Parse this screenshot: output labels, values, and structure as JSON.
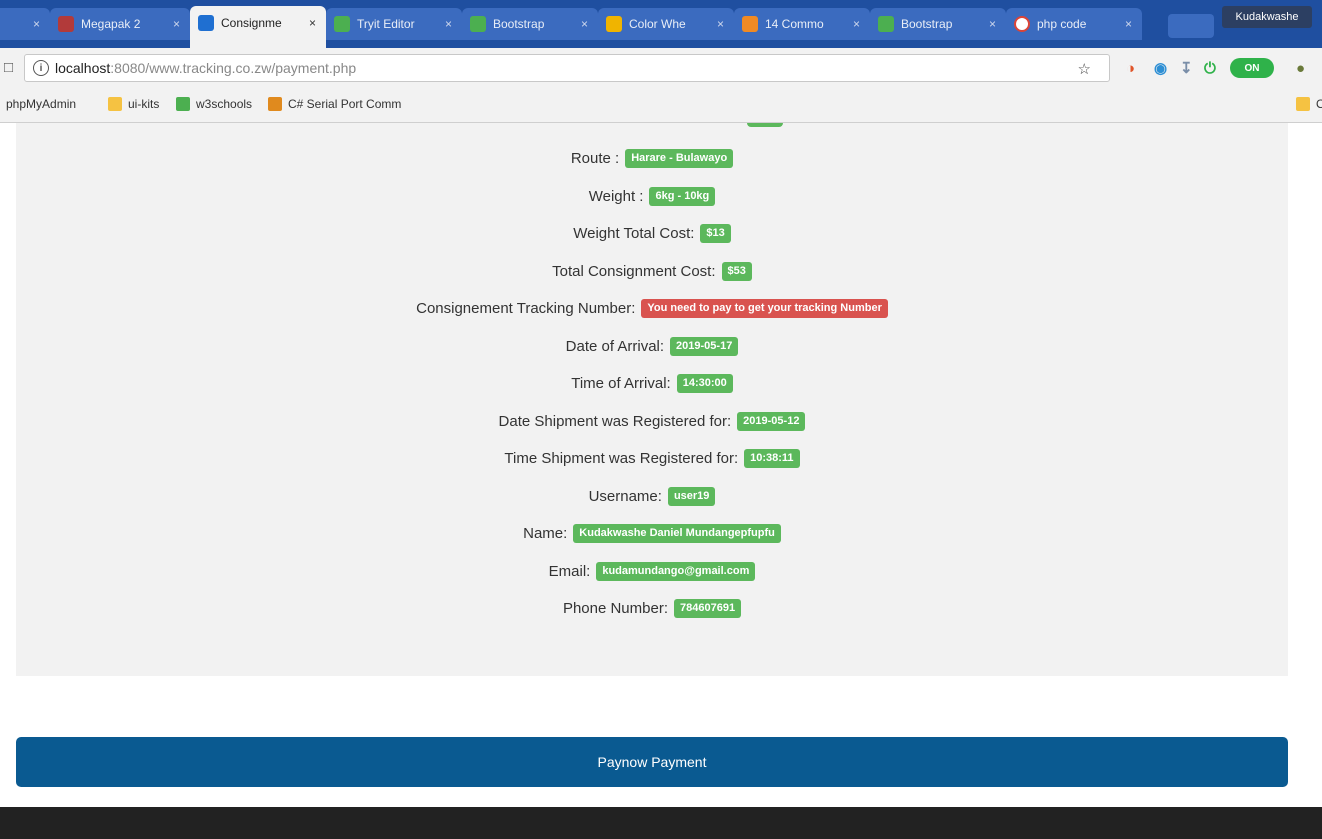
{
  "browser": {
    "tabs": [
      {
        "title": "",
        "favicon_color": "#3b6bbf",
        "active": false
      },
      {
        "title": "Megapak 2",
        "favicon_color": "#b23a3a",
        "active": false
      },
      {
        "title": "Consignme",
        "favicon_color": "#1f6fd1",
        "active": true
      },
      {
        "title": "Tryit Editor",
        "favicon_color": "#4caf50",
        "active": false
      },
      {
        "title": "Bootstrap",
        "favicon_color": "#4caf50",
        "active": false
      },
      {
        "title": "Color Whe",
        "favicon_color": "#f0b400",
        "active": false
      },
      {
        "title": "14 Commo",
        "favicon_color": "#f08a24",
        "active": false
      },
      {
        "title": "Bootstrap",
        "favicon_color": "#4caf50",
        "active": false
      },
      {
        "title": "php code",
        "favicon_color": "#ffffff",
        "active": false
      }
    ],
    "tab_close_glyph": "×",
    "profile_name": "Kudakwashe",
    "url_host": "localhost",
    "url_rest": ":8080/www.tracking.co.zw/payment.php",
    "toggle_label": "ON",
    "bookmarks": [
      {
        "label": "phpMyAdmin",
        "icon_color": ""
      },
      {
        "label": "ui-kits",
        "icon_color": "#f5c242"
      },
      {
        "label": "w3schools",
        "icon_color": "#4caf50"
      },
      {
        "label": "C# Serial Port Comm",
        "icon_color": "#e08a1e"
      }
    ],
    "bookmark_overflow": "O"
  },
  "details": [
    {
      "label": "Route :",
      "value": "Harare - Bulawayo",
      "status": "success"
    },
    {
      "label": "Weight :",
      "value": "6kg - 10kg",
      "status": "success"
    },
    {
      "label": "Weight Total Cost:",
      "value": "$13",
      "status": "success"
    },
    {
      "label": "Total Consignment Cost:",
      "value": "$53",
      "status": "success"
    },
    {
      "label": "Consignement Tracking Number:",
      "value": "You need to pay to get your tracking Number",
      "status": "danger"
    },
    {
      "label": "Date of Arrival:",
      "value": "2019-05-17",
      "status": "success"
    },
    {
      "label": "Time of Arrival:",
      "value": "14:30:00",
      "status": "success"
    },
    {
      "label": "Date Shipment was Registered for:",
      "value": "2019-05-12",
      "status": "success"
    },
    {
      "label": "Time Shipment was Registered for:",
      "value": "10:38:11",
      "status": "success"
    },
    {
      "label": "Username:",
      "value": "user19",
      "status": "success"
    },
    {
      "label": "Name:",
      "value": "Kudakwashe Daniel Mundangepfupfu",
      "status": "success"
    },
    {
      "label": "Email:",
      "value": "kudamundango@gmail.com",
      "status": "success"
    },
    {
      "label": "Phone Number:",
      "value": "784607691",
      "status": "success"
    }
  ],
  "payment_button_label": "Paynow Payment",
  "colors": {
    "success": "#5cb85c",
    "danger": "#d9534f",
    "primary_button": "#0a5a91",
    "footer": "#222222",
    "panel": "#f2f2f2"
  }
}
